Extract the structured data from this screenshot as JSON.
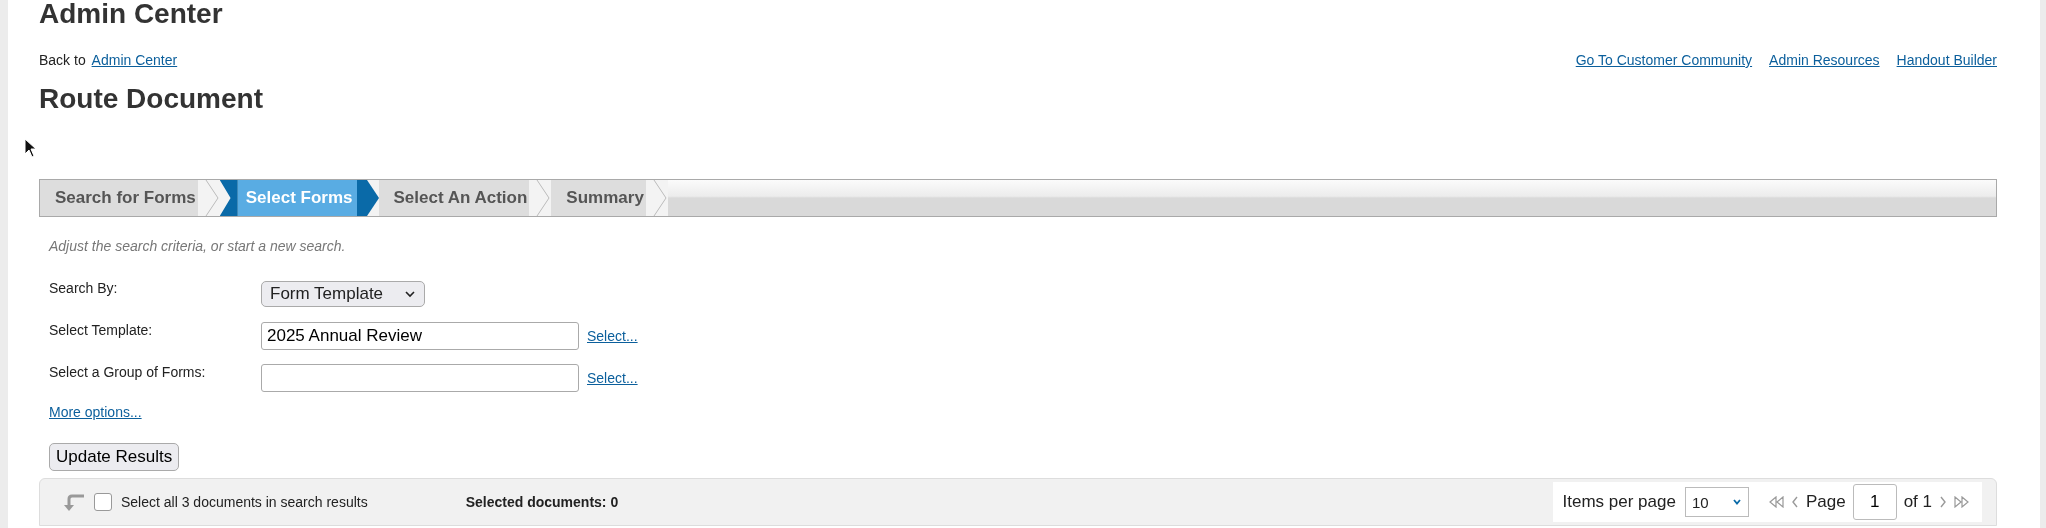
{
  "header": {
    "title": "Admin Center",
    "back_text": "Back to",
    "back_link": "Admin Center",
    "links": [
      "Go To Customer Community",
      "Admin Resources",
      "Handout Builder"
    ]
  },
  "page_title": "Route Document",
  "steps": [
    {
      "label": "Search for Forms",
      "selected": false
    },
    {
      "label": "Select Forms",
      "selected": true
    },
    {
      "label": "Select An Action",
      "selected": false
    },
    {
      "label": "Summary",
      "selected": false
    }
  ],
  "hint": "Adjust the search criteria, or start a new search.",
  "form": [
    {
      "kind": "select",
      "label": "Search By:",
      "value": "Form Template"
    },
    {
      "kind": "text",
      "label": "Select Template:",
      "value": "2025 Annual Review",
      "link": "Select..."
    },
    {
      "kind": "text",
      "label": "Select a Group of Forms:",
      "link": "Select..."
    }
  ],
  "more_options": "More options...",
  "update_button": "Update Results",
  "results_bar": {
    "select_all": "Select all 3 documents in search results",
    "checked": false,
    "selected_count": "Selected documents: 0",
    "items_per_page_label": "Items per page",
    "items_per_page": "10",
    "page_label": "Page",
    "page": "1",
    "of_pages": "of 1"
  }
}
